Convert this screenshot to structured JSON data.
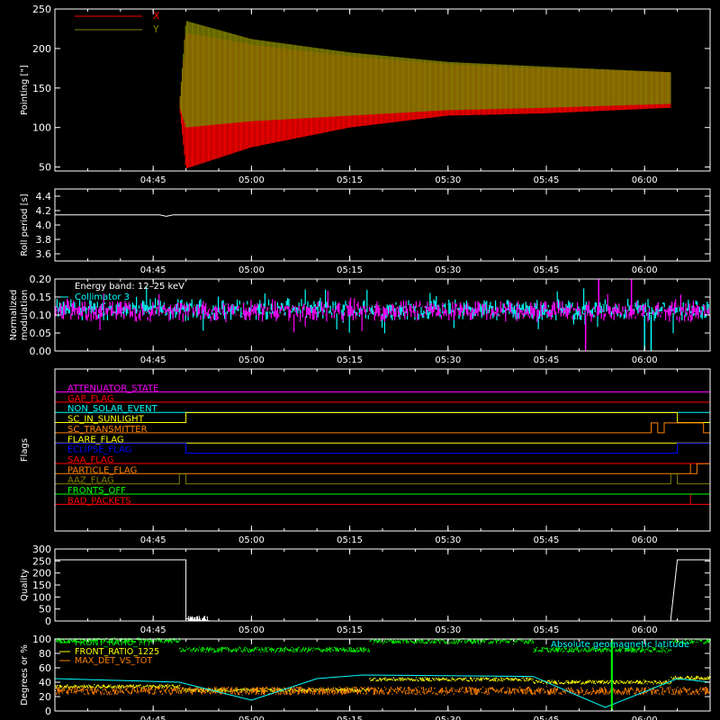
{
  "colors": {
    "background": "#000000",
    "axes": "#ffffff",
    "red": "#ff0000",
    "olive": "#808000",
    "cyan": "#00ffff",
    "magenta": "#ff00ff",
    "orange": "#ff8000",
    "yellow": "#ffff00",
    "green": "#00ff00",
    "blue": "#0000ff",
    "gray": "#b0b0b0"
  },
  "time_ticks": [
    "04:45",
    "05:00",
    "05:15",
    "05:30",
    "05:45",
    "06:00"
  ],
  "chart_data": [
    {
      "id": "pointing",
      "type": "line",
      "ylabel": "Pointing [\"]",
      "ylim": [
        45,
        250
      ],
      "yticks": [
        "50",
        "100",
        "150",
        "200",
        "250"
      ],
      "legend": [
        {
          "label": "X",
          "color": "red"
        },
        {
          "label": "Y",
          "color": "olive"
        }
      ],
      "series": [
        {
          "name": "X",
          "color": "red",
          "envelope": [
            {
              "t": "04:30",
              "lo": 127,
              "hi": 127
            },
            {
              "t": "04:49",
              "lo": 127,
              "hi": 127
            },
            {
              "t": "04:50",
              "lo": 48,
              "hi": 220
            },
            {
              "t": "05:00",
              "lo": 75,
              "hi": 205
            },
            {
              "t": "05:15",
              "lo": 100,
              "hi": 190
            },
            {
              "t": "05:30",
              "lo": 115,
              "hi": 180
            },
            {
              "t": "05:45",
              "lo": 118,
              "hi": 175
            },
            {
              "t": "06:04",
              "lo": 125,
              "hi": 170
            },
            {
              "t": "06:04",
              "lo": 127,
              "hi": 127
            },
            {
              "t": "06:10",
              "lo": 127,
              "hi": 127
            }
          ]
        },
        {
          "name": "Y",
          "color": "olive",
          "envelope": [
            {
              "t": "04:30",
              "lo": 127,
              "hi": 127
            },
            {
              "t": "04:49",
              "lo": 127,
              "hi": 127
            },
            {
              "t": "04:50",
              "lo": 100,
              "hi": 235
            },
            {
              "t": "05:00",
              "lo": 108,
              "hi": 212
            },
            {
              "t": "05:15",
              "lo": 115,
              "hi": 195
            },
            {
              "t": "05:30",
              "lo": 122,
              "hi": 183
            },
            {
              "t": "05:45",
              "lo": 125,
              "hi": 177
            },
            {
              "t": "06:04",
              "lo": 130,
              "hi": 170
            },
            {
              "t": "06:04",
              "lo": 127,
              "hi": 127
            },
            {
              "t": "06:10",
              "lo": 127,
              "hi": 127
            }
          ]
        }
      ]
    },
    {
      "id": "roll",
      "type": "line",
      "ylabel": "Roll period [s]",
      "ylim": [
        3.5,
        4.5
      ],
      "yticks": [
        "3.6",
        "3.8",
        "4.0",
        "4.2",
        "4.4"
      ],
      "series": [
        {
          "name": "",
          "color": "axes",
          "points": [
            [
              "04:30",
              4.14
            ],
            [
              "04:46",
              4.14
            ],
            [
              "04:47",
              4.12
            ],
            [
              "04:48",
              4.14
            ],
            [
              "06:10",
              4.14
            ]
          ]
        }
      ]
    },
    {
      "id": "modulation",
      "type": "line",
      "ylabel": "Normalized modulation",
      "ylabel_lines": [
        "Normalized",
        "modulation"
      ],
      "ylim": [
        0.0,
        0.2
      ],
      "yticks": [
        "0.00",
        "0.05",
        "0.10",
        "0.15",
        "0.20"
      ],
      "annotation": "Energy band: 12–25 keV",
      "legend": [
        {
          "label": "Collimator 3",
          "color": "cyan"
        }
      ],
      "series": [
        {
          "name": "Collimator 3",
          "color": "cyan",
          "baseline": 0.115,
          "spread": 0.03
        },
        {
          "name": "",
          "color": "magenta",
          "baseline": 0.11,
          "spread": 0.03
        }
      ],
      "spikes": [
        {
          "t": "05:51",
          "value": 0.0,
          "color": "magenta"
        },
        {
          "t": "06:00",
          "value": 0.0,
          "color": "cyan"
        },
        {
          "t": "06:01",
          "value": 0.0,
          "color": "cyan"
        },
        {
          "t": "05:58",
          "value": 0.2,
          "color": "magenta"
        },
        {
          "t": "05:53",
          "value": 0.2,
          "color": "magenta"
        }
      ]
    },
    {
      "id": "flags",
      "type": "line",
      "ylabel": "Flags",
      "flags": [
        {
          "label": "ATTENUATOR_STATE",
          "color": "magenta",
          "transitions": []
        },
        {
          "label": "GAP_FLAG",
          "color": "red",
          "transitions": []
        },
        {
          "label": "NON_SOLAR_EVENT",
          "color": "cyan",
          "transitions": []
        },
        {
          "label": "SC_IN_SUNLIGHT",
          "color": "yellow",
          "transitions": [
            [
              "04:30",
              0
            ],
            [
              "04:50",
              1
            ],
            [
              "06:05",
              0
            ]
          ]
        },
        {
          "label": "SC_TRANSMITTER",
          "color": "orange",
          "transitions": [
            [
              "04:30",
              0
            ],
            [
              "06:01",
              1
            ],
            [
              "06:02",
              0
            ],
            [
              "06:03",
              1
            ],
            [
              "06:09",
              0
            ]
          ]
        },
        {
          "label": "FLARE_FLAG",
          "color": "yellow",
          "transitions": []
        },
        {
          "label": "ECLIPSE_FLAG",
          "color": "blue",
          "transitions": [
            [
              "04:30",
              1
            ],
            [
              "04:50",
              0
            ],
            [
              "06:05",
              1
            ]
          ]
        },
        {
          "label": "SAA_FLAG",
          "color": "red",
          "transitions": []
        },
        {
          "label": "PARTICLE_FLAG",
          "color": "orange",
          "transitions": [
            [
              "04:30",
              0
            ],
            [
              "06:07",
              1
            ],
            [
              "06:07",
              0
            ],
            [
              "06:08",
              1
            ]
          ]
        },
        {
          "label": "AAZ_FLAG",
          "color": "olive",
          "transitions": [
            [
              "04:30",
              0
            ],
            [
              "04:49",
              1
            ],
            [
              "04:50",
              0
            ],
            [
              "06:04",
              1
            ],
            [
              "06:05",
              0
            ]
          ]
        },
        {
          "label": "FRONTS_OFF",
          "color": "green",
          "transitions": []
        },
        {
          "label": "BAD_PACKETS",
          "color": "red",
          "transitions": [
            [
              "04:30",
              0
            ],
            [
              "06:07",
              1
            ],
            [
              "06:07",
              0
            ]
          ]
        }
      ]
    },
    {
      "id": "quality",
      "type": "line",
      "ylabel": "Quality",
      "ylim": [
        0,
        300
      ],
      "yticks": [
        "0",
        "50",
        "100",
        "150",
        "200",
        "250",
        "300"
      ],
      "series": [
        {
          "name": "",
          "color": "axes",
          "points": [
            [
              "04:30",
              255
            ],
            [
              "04:50",
              255
            ],
            [
              "04:50",
              10
            ],
            [
              "04:51",
              5
            ],
            [
              "04:52",
              3
            ],
            [
              "04:53",
              1
            ],
            [
              "04:54",
              0
            ],
            [
              "06:04",
              0
            ],
            [
              "06:04",
              8
            ],
            [
              "06:05",
              255
            ],
            [
              "06:10",
              255
            ]
          ]
        }
      ]
    },
    {
      "id": "ratios",
      "type": "line",
      "ylabel": "Degrees or %",
      "ylim": [
        0,
        100
      ],
      "yticks": [
        "0",
        "20",
        "40",
        "60",
        "80",
        "100"
      ],
      "annotation": "Absolute geomagnetic latitude",
      "legend": [
        {
          "label": "FRONT_RATIO_???",
          "color": "green"
        },
        {
          "label": "FRONT_RATIO_1225",
          "color": "yellow"
        },
        {
          "label": "MAX_DET_VS_TOT",
          "color": "orange"
        }
      ],
      "series": [
        {
          "name": "FRONT_RATIO_???",
          "color": "green",
          "segments": [
            [
              "04:30",
              "04:49",
              98
            ],
            [
              "04:49",
              "05:18",
              85
            ],
            [
              "05:18",
              "05:43",
              97
            ],
            [
              "05:43",
              "06:04",
              85
            ],
            [
              "06:04",
              "06:10",
              97
            ]
          ],
          "spread": 4
        },
        {
          "name": "FRONT_RATIO_1225",
          "color": "yellow",
          "segments": [
            [
              "04:30",
              "04:49",
              34
            ],
            [
              "04:49",
              "05:18",
              29
            ],
            [
              "05:18",
              "05:43",
              44
            ],
            [
              "05:43",
              "06:04",
              40
            ],
            [
              "06:04",
              "06:10",
              46
            ]
          ],
          "spread": 3
        },
        {
          "name": "MAX_DET_VS_TOT",
          "color": "orange",
          "segments": [
            [
              "04:30",
              "06:10",
              28
            ]
          ],
          "spread": 6
        },
        {
          "name": "Absolute geomagnetic latitude",
          "color": "cyan",
          "points": [
            [
              "04:30",
              45
            ],
            [
              "04:49",
              40
            ],
            [
              "05:00",
              15
            ],
            [
              "05:10",
              45
            ],
            [
              "05:17",
              50
            ],
            [
              "05:43",
              48
            ],
            [
              "05:54",
              5
            ],
            [
              "06:05",
              45
            ],
            [
              "06:10",
              40
            ]
          ]
        }
      ],
      "markers": [
        {
          "t": "05:55",
          "color": "green"
        }
      ]
    }
  ]
}
